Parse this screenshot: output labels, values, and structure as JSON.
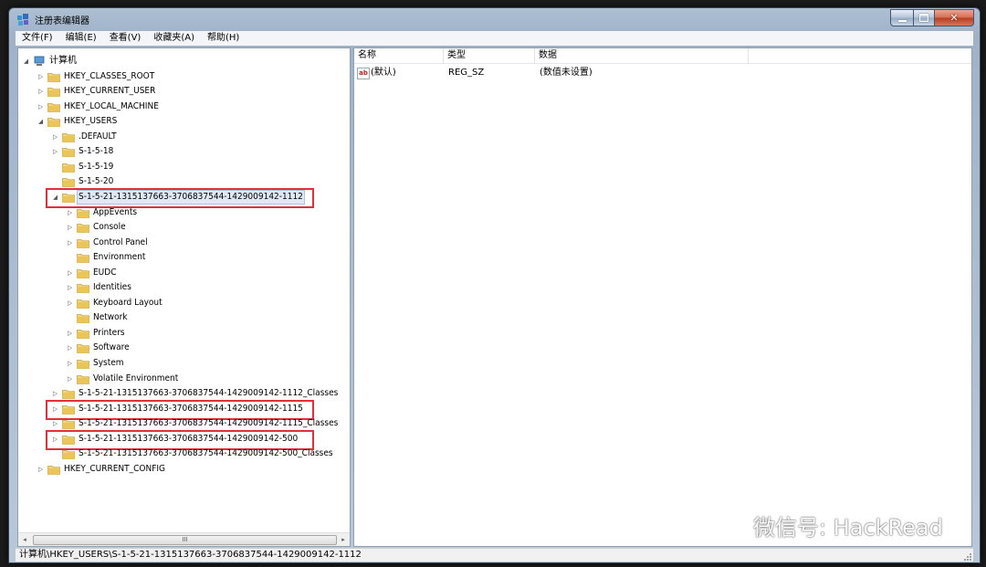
{
  "window": {
    "title": "注册表编辑器"
  },
  "menu": [
    "文件(F)",
    "编辑(E)",
    "查看(V)",
    "收藏夹(A)",
    "帮助(H)"
  ],
  "tree": [
    {
      "label": "计算机",
      "level": 0,
      "expander": "open",
      "icon": "computer"
    },
    {
      "label": "HKEY_CLASSES_ROOT",
      "level": 1,
      "expander": "closed"
    },
    {
      "label": "HKEY_CURRENT_USER",
      "level": 1,
      "expander": "closed"
    },
    {
      "label": "HKEY_LOCAL_MACHINE",
      "level": 1,
      "expander": "closed"
    },
    {
      "label": "HKEY_USERS",
      "level": 1,
      "expander": "open"
    },
    {
      "label": ".DEFAULT",
      "level": 2,
      "expander": "closed"
    },
    {
      "label": "S-1-5-18",
      "level": 2,
      "expander": "closed"
    },
    {
      "label": "S-1-5-19",
      "level": 2,
      "expander": "none"
    },
    {
      "label": "S-1-5-20",
      "level": 2,
      "expander": "none"
    },
    {
      "label": "S-1-5-21-1315137663-3706837544-1429009142-1112",
      "level": 2,
      "expander": "open",
      "selected": true,
      "highlight": true
    },
    {
      "label": "AppEvents",
      "level": 3,
      "expander": "closed"
    },
    {
      "label": "Console",
      "level": 3,
      "expander": "closed"
    },
    {
      "label": "Control Panel",
      "level": 3,
      "expander": "closed"
    },
    {
      "label": "Environment",
      "level": 3,
      "expander": "none"
    },
    {
      "label": "EUDC",
      "level": 3,
      "expander": "closed"
    },
    {
      "label": "Identities",
      "level": 3,
      "expander": "closed"
    },
    {
      "label": "Keyboard Layout",
      "level": 3,
      "expander": "closed"
    },
    {
      "label": "Network",
      "level": 3,
      "expander": "none"
    },
    {
      "label": "Printers",
      "level": 3,
      "expander": "closed"
    },
    {
      "label": "Software",
      "level": 3,
      "expander": "closed"
    },
    {
      "label": "System",
      "level": 3,
      "expander": "closed"
    },
    {
      "label": "Volatile Environment",
      "level": 3,
      "expander": "closed"
    },
    {
      "label": "S-1-5-21-1315137663-3706837544-1429009142-1112_Classes",
      "level": 2,
      "expander": "closed"
    },
    {
      "label": "S-1-5-21-1315137663-3706837544-1429009142-1115",
      "level": 2,
      "expander": "closed",
      "highlight": true
    },
    {
      "label": "S-1-5-21-1315137663-3706837544-1429009142-1115_Classes",
      "level": 2,
      "expander": "closed"
    },
    {
      "label": "S-1-5-21-1315137663-3706837544-1429009142-500",
      "level": 2,
      "expander": "closed",
      "highlight": true
    },
    {
      "label": "S-1-5-21-1315137663-3706837544-1429009142-500_Classes",
      "level": 2,
      "expander": "none"
    },
    {
      "label": "HKEY_CURRENT_CONFIG",
      "level": 1,
      "expander": "closed"
    }
  ],
  "tree_scroll": {
    "thumb_grip": "III",
    "left_arrow": "◂",
    "right_arrow": "▸"
  },
  "list": {
    "columns": [
      "名称",
      "类型",
      "数据"
    ],
    "rows": [
      {
        "name": "(默认)",
        "type": "REG_SZ",
        "data": "(数值未设置)",
        "icon": "ab"
      }
    ]
  },
  "status": "计算机\\HKEY_USERS\\S-1-5-21-1315137663-3706837544-1429009142-1112",
  "watermark": "微信号: HackRead",
  "colors": {
    "highlight_box": "#e0303a",
    "folder": "#e9c55a"
  }
}
